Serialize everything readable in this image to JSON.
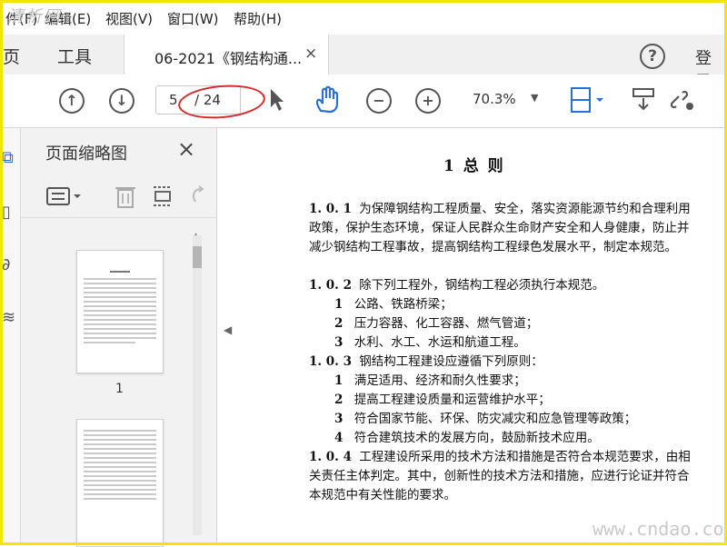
{
  "watermark_top": "清析网",
  "menu": [
    "件(F)",
    "编辑(E)",
    "视图(V)",
    "窗口(W)",
    "帮助(H)"
  ],
  "tabs": {
    "home": "主页",
    "tools": "工具",
    "doc_title": "06-2021《钢结构通...",
    "close": "×"
  },
  "header": {
    "help": "?",
    "login": "登录"
  },
  "toolbar": {
    "page_current": "5",
    "page_total": "/ 24",
    "zoom": "70.3%"
  },
  "thumbnails": {
    "title": "页面缩略图",
    "close": "×",
    "page_label": "1"
  },
  "document": {
    "title": "1 总 则",
    "paragraphs": [
      {
        "num": "1. 0. 1",
        "text": "为保障钢结构工程质量、安全，落实资源能源节约和合理利用政策，保护生态环境，保证人民群众生命财产安全和人身健康，防止并减少钢结构工程事故，提高钢结构工程绿色发展水平，制定本规范。"
      },
      {
        "num": "1. 0. 2",
        "text": "除下列工程外，钢结构工程必须执行本规范。"
      },
      {
        "num": "1",
        "text": "公路、铁路桥梁；"
      },
      {
        "num": "2",
        "text": "压力容器、化工容器、燃气管道；"
      },
      {
        "num": "3",
        "text": "水利、水工、水运和航道工程。"
      },
      {
        "num": "1. 0. 3",
        "text": "钢结构工程建设应遵循下列原则："
      },
      {
        "num": "1",
        "text": "满足适用、经济和耐久性要求；"
      },
      {
        "num": "2",
        "text": "提高工程建设质量和运营维护水平；"
      },
      {
        "num": "3",
        "text": "符合国家节能、环保、防灾减灾和应急管理等政策；"
      },
      {
        "num": "4",
        "text": "符合建筑技术的发展方向，鼓励新技术应用。"
      },
      {
        "num": "1. 0. 4",
        "text": "工程建设所采用的技术方法和措施是否符合本规范要求，由相关责任主体判定。其中，创新性的技术方法和措施，应进行论证并符合本规范中有关性能的要求。"
      }
    ]
  },
  "watermark_bottom": "www.cndao.com",
  "colors": {
    "accent": "#2a6fd6",
    "frame": "#f3e500",
    "highlight": "#d8282a"
  }
}
